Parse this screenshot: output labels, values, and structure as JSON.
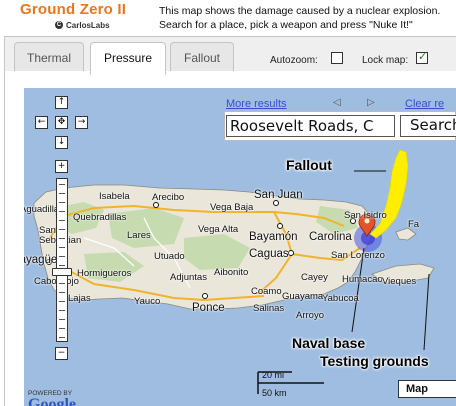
{
  "header": {
    "title": "Ground Zero II",
    "brand": "CarlosLabs",
    "brand_mark": "C",
    "intro": "This map shows the damage caused by a nuclear explosion. Search for a place, pick a weapon and press \"Nuke It!\""
  },
  "tabs": [
    {
      "label": "Thermal",
      "active": false
    },
    {
      "label": "Pressure",
      "active": true
    },
    {
      "label": "Fallout",
      "active": false
    }
  ],
  "options": {
    "autozoom_label": "Autozoom:",
    "autozoom_checked": false,
    "lockmap_label": "Lock map:",
    "lockmap_checked": true,
    "checkmark": "✓"
  },
  "search": {
    "more_results": "More results",
    "clear_results": "Clear re",
    "prev": "◁",
    "next": "▷",
    "value": "Roosevelt Roads, C",
    "button": "Search"
  },
  "map_controls": {
    "pan_up": "↑",
    "pan_left": "←",
    "pan_center": "✥",
    "pan_right": "→",
    "pan_down": "↓",
    "zoom_in": "+",
    "zoom_out": "−"
  },
  "places": {
    "isabela": "Isabela",
    "arecibo": "Arecibo",
    "san_juan": "San Juan",
    "aguadilla": "Aguadilla",
    "quebradillas": "Quebradillas",
    "vega_baja": "Vega Baja",
    "san_sebastian": "San\nSebastian",
    "lares": "Lares",
    "vega_alta": "Vega Alta",
    "bayamon": "Bayamón",
    "carolina": "Carolina",
    "san_isidro": "San Isidro",
    "fajardo": "Fa",
    "mayaguez": "Mayagüez",
    "utuado": "Utuado",
    "caguas": "Caguas",
    "san_lorenzo": "San Lorenzo",
    "cabo_rojo": "Cabo Rojo",
    "hormigueros": "Hormigueros",
    "adjuntas": "Adjuntas",
    "aibonito": "Aibonito",
    "cayey": "Cayey",
    "humacao": "Humacao",
    "yabucoa": "Yabucoa",
    "lajas": "Lajas",
    "yauco": "Yauco",
    "ponce": "Ponce",
    "coamo": "Coamo",
    "guayama": "Guayama",
    "salinas": "Salinas",
    "arroyo": "Arroyo",
    "vieques": "Vieques"
  },
  "annotations": {
    "fallout": "Fallout",
    "naval_base": "Naval base",
    "testing_grounds": "Testing grounds"
  },
  "scale": {
    "miles": "20 mi",
    "km": "50 km"
  },
  "map_type": "Map",
  "powered_by": "POWERED BY",
  "google": "Google",
  "colors": {
    "title_orange": "#e8771e",
    "water": "#9fbde0",
    "land": "#eae6da",
    "forest": "#c6dbb0",
    "fallout_yellow": "#ffee00",
    "blast_blue": "#4a55e0",
    "marker_red": "#e5532a",
    "link_blue": "#3b4bd0"
  },
  "icons": {
    "map_marker": "map-marker-icon",
    "checkmark": "checkmark-icon"
  }
}
